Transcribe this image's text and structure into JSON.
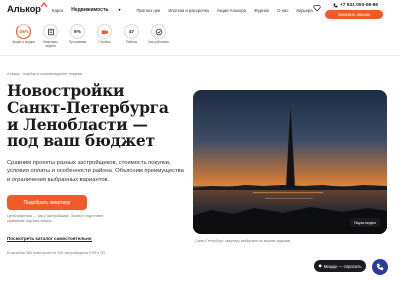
{
  "header": {
    "logo": "Алькор",
    "nav": [
      {
        "label": "Карта"
      },
      {
        "label": "Недвижимость"
      },
      {
        "label": "Прогноз цен"
      },
      {
        "label": "Ипотека и рассрочка"
      },
      {
        "label": "Акции Алькора"
      },
      {
        "label": "Журнал"
      },
      {
        "label": "О нас"
      },
      {
        "label": "Карьера"
      }
    ],
    "phone": "+7 931 000-08-86",
    "callback_label": "Заказать звонок"
  },
  "stats": [
    {
      "value": "-36%",
      "label": "Акции и скидки",
      "highlight": true
    },
    {
      "value": "",
      "label": "Квартиры недели",
      "icon": "apartment-icon"
    },
    {
      "value": "6%",
      "label": "Программы",
      "highlight": false
    },
    {
      "value": "",
      "label": "Стройка",
      "icon": "camera-icon"
    },
    {
      "value": "47",
      "label": "Районы",
      "highlight": false
    },
    {
      "value": "",
      "label": "Как работаем",
      "icon": "check-icon"
    }
  ],
  "hero": {
    "breadcrumb": "Алькор · подбор и сопровождение покупки",
    "title_lines": [
      "Новостройки",
      "Санкт-Петербурга",
      "и Ленобласти —",
      "под ваш бюджет"
    ],
    "lead": "Сравним проекты разных застройщиков, стоимость покупки, условия оплаты и особенности района. Объясним преимущества и ограничения выбранных вариантов.",
    "cta_label": "Подобрать квартиру",
    "note": "Цена квартиры — как у застройщика. Эксперт подготовит сравнение под ваш запрос.",
    "catalog_link": "Посмотреть каталог самостоятельно",
    "catalog_note": "В каталоге 365 новостроек от 150 застройщиков СПб и ЛО",
    "video_label": "Пауза видео",
    "caption": "Санкт-Петербург: квартиру выбираем по вашим задачам"
  },
  "chat": {
    "label": "Мицар — спросить"
  },
  "colors": {
    "accent": "#f05a28",
    "dark": "#1b1b1f",
    "fab": "#2d3b9a"
  }
}
